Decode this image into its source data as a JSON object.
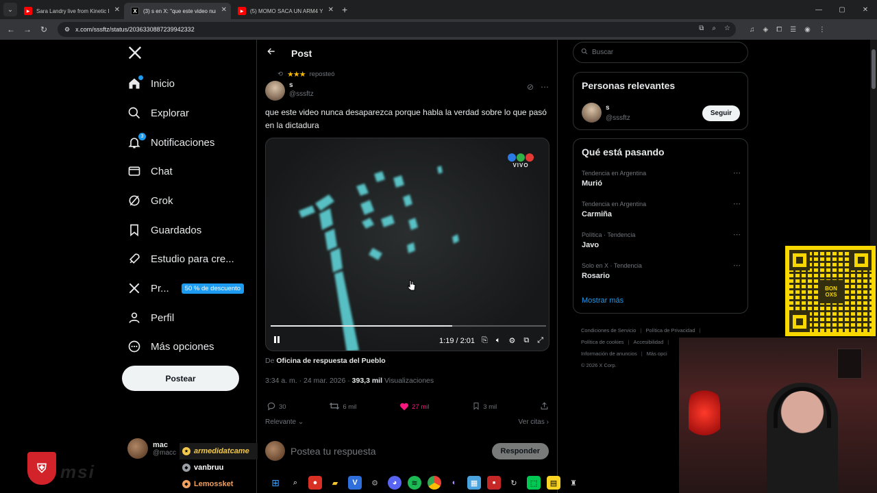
{
  "browser": {
    "tabs": [
      {
        "title": "Sara Landry live from Kinetic Fi",
        "favicon": "youtube-icon",
        "active": false
      },
      {
        "title": "(3) s en X: \"que este video nunc",
        "favicon": "x-logo-icon",
        "active": false
      },
      {
        "title": "(5) MOMO SACA UN ARM4 Y D",
        "favicon": "youtube-icon",
        "active": true
      }
    ],
    "url": "x.com/sssftz/status/2036330887239942332"
  },
  "nav": {
    "items": [
      {
        "label": "Inicio",
        "icon": "home-icon"
      },
      {
        "label": "Explorar",
        "icon": "search-icon"
      },
      {
        "label": "Notificaciones",
        "icon": "bell-icon",
        "badge": "3"
      },
      {
        "label": "Chat",
        "icon": "mail-icon"
      },
      {
        "label": "Grok",
        "icon": "grok-icon"
      },
      {
        "label": "Guardados",
        "icon": "bookmark-icon"
      },
      {
        "label": "Estudio para cre...",
        "icon": "rocket-icon"
      },
      {
        "label": "Pr...",
        "icon": "x-logo-icon",
        "promo": "50 % de descuento"
      },
      {
        "label": "Perfil",
        "icon": "person-icon"
      },
      {
        "label": "Más opciones",
        "icon": "more-circle-icon"
      }
    ],
    "post_button": "Postear",
    "account": {
      "name": "mac",
      "handle": "@macc"
    }
  },
  "post": {
    "header_title": "Post",
    "reposted_by": "reposteó",
    "author_name": "s",
    "author_handle": "@sssftz",
    "text": "que este video nunca desaparezca porque habla la verdad sobre lo que pasó en la dictadura",
    "video": {
      "live_label": "VIVO",
      "time": "1:19 / 2:01",
      "progress": 0.66
    },
    "source_prefix": "De",
    "source_name": "Oficina de respuesta del Pueblo",
    "timestamp": "3:34 a. m. · 24 mar. 2026 ·",
    "views_count": "393,3 mil",
    "views_label": "Visualizaciones",
    "replies": "30",
    "reposts": "6 mil",
    "likes": "27 mil",
    "bookmarks": "3 mil",
    "sort_label": "Relevante",
    "quotes_label": "Ver citas",
    "reply_placeholder": "Postea tu respuesta",
    "reply_button": "Responder"
  },
  "sidebar": {
    "search_placeholder": "Buscar",
    "relevant_title": "Personas relevantes",
    "relevant_person": {
      "name": "s",
      "handle": "@sssftz",
      "button": "Seguir"
    },
    "trends_title": "Qué está pasando",
    "trends": [
      {
        "category": "Tendencia en Argentina",
        "name": "Murió"
      },
      {
        "category": "Tendencia en Argentina",
        "name": "Carmiña"
      },
      {
        "category": "Política · Tendencia",
        "name": "Javo"
      },
      {
        "category": "Solo en X · Tendencia",
        "name": "Rosario"
      }
    ],
    "show_more": "Mostrar más",
    "footer_links": [
      "Condiciones de Servicio",
      "Política de Privacidad",
      "Política de cookies",
      "Accesibilidad",
      "Información de anuncios",
      "Más opci"
    ],
    "copyright": "© 2026 X Corp."
  },
  "overlay": {
    "qr_text": "BON OXS",
    "chat": [
      {
        "user": "armedidatcame",
        "style": "gold"
      },
      {
        "user": "vanbruu",
        "style": "white"
      },
      {
        "user": "Lemossket",
        "style": "orange"
      }
    ],
    "msi_logo": "msi"
  },
  "colors": {
    "accent": "#1d9bf0",
    "like": "#f91880",
    "background": "#000000"
  }
}
